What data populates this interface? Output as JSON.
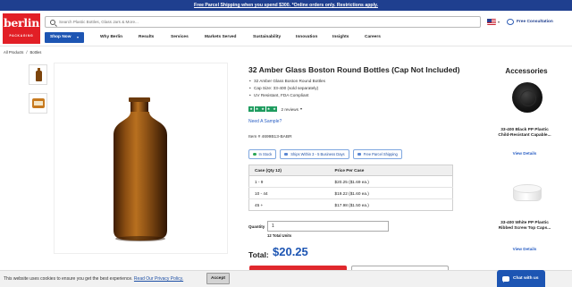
{
  "promo": {
    "text": "Free Parcel Shipping when you spend $300. *Online orders only. Restrictions apply."
  },
  "logo": {
    "word": "berlin",
    "sub": "PACKAGING"
  },
  "search": {
    "placeholder": "Search Plastic Bottles, Glass Jars & More..."
  },
  "header": {
    "consult_label": "Free Consultation"
  },
  "nav": {
    "shop_label": "Shop Now",
    "items": [
      "Why Berlin",
      "Results",
      "Services",
      "Markets Served",
      "Sustainability",
      "Innovation",
      "Insights",
      "Careers"
    ]
  },
  "breadcrumb": [
    "All Products",
    "/",
    "Bottles"
  ],
  "product": {
    "title": "32 Amber Glass Boston Round Bottles (Cap Not Included)",
    "bullets": [
      "32 Amber Glass Boston Round Bottles",
      "Cap Size: 33-400 (sold separately)",
      "UV Resistant, FDA Compliant"
    ],
    "rating_stars": 5,
    "reviews_label": "2 reviews",
    "sample_link": "Need A Sample?",
    "item_number": "Item # 4699B13-BABR",
    "badges": [
      "In Stock",
      "Ships Within 3 - 5 Business Days",
      "Free Parcel Shipping"
    ],
    "badge_colors": {
      "stock_dot": "#2ca655",
      "border": "#7fa7e0"
    }
  },
  "pricing": {
    "headers": [
      "Case (Qty 12)",
      "Price Per Case"
    ],
    "rows": [
      [
        "1 - 9",
        "$20.25 ($1.69 ea.)"
      ],
      [
        "10 - 44",
        "$19.22 ($1.60 ea.)"
      ],
      [
        "45 +",
        "$17.98 ($1.50 ea.)"
      ]
    ]
  },
  "quantity": {
    "label": "Quantity",
    "value": "1",
    "units": "12 Total Units"
  },
  "total": {
    "label": "Total:",
    "value": "$20.25"
  },
  "accessories": {
    "title": "Accessories",
    "items": [
      {
        "name": "33-400 Black PP Plastic Child-Resistant Capable...",
        "link": "View Details",
        "icon": "black-cap-icon"
      },
      {
        "name": "33-400 White PP Plastic Ribbed Screw Top Caps...",
        "link": "View Details",
        "icon": "white-cap-icon"
      }
    ]
  },
  "cookie": {
    "text": "This website uses cookies to ensure you get the best experience.",
    "link": "Read Our Privacy Policy.",
    "accept": "Accept"
  },
  "chat": {
    "label": "Chat with us"
  },
  "colors": {
    "brand_red": "#e21f26",
    "brand_blue": "#1d55b3",
    "promo_bar": "#1f3f8f",
    "rating_green": "#1e9c5f"
  }
}
